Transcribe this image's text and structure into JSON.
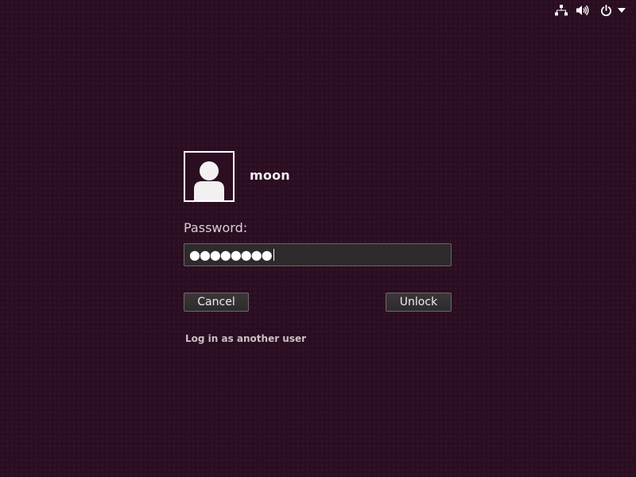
{
  "panel": {
    "icons": [
      "network-icon",
      "sound-icon",
      "power-icon",
      "menu-arrow-icon"
    ]
  },
  "user": {
    "name": "moon",
    "avatar_icon": "user-avatar-icon"
  },
  "password": {
    "label": "Password:",
    "masked_value": "●●●●●●●●"
  },
  "buttons": {
    "cancel_label": "Cancel",
    "unlock_label": "Unlock"
  },
  "links": {
    "another_user": "Log in as another user"
  },
  "colors": {
    "background": "#2c0e23",
    "field_background": "#2f2b2d",
    "text": "#e9e2e6"
  }
}
